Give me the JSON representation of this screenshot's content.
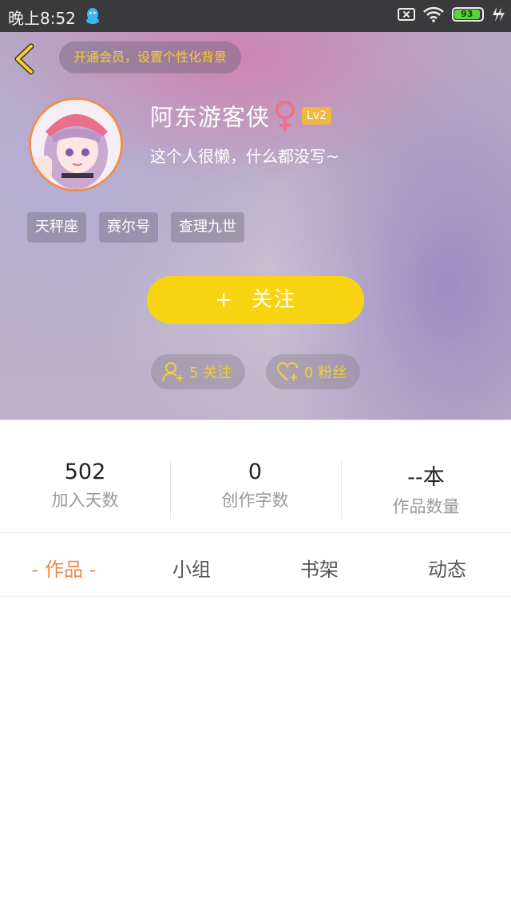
{
  "status_bar": {
    "time": "晚上8:52",
    "battery": "93"
  },
  "header": {
    "vip_prompt": "开通会员，设置个性化背景",
    "username": "阿东游客侠",
    "level": "Lv2",
    "bio": "这个人很懒，什么都没写~",
    "tags": [
      "天秤座",
      "赛尔号",
      "查理九世"
    ],
    "follow_button": {
      "plus": "+",
      "label": "关注"
    },
    "following": "5 关注",
    "fans": "0 粉丝"
  },
  "stats": [
    {
      "value": "502",
      "label": "加入天数"
    },
    {
      "value": "0",
      "label": "创作字数"
    },
    {
      "value": "--本",
      "label": "作品数量"
    }
  ],
  "tabs": [
    {
      "label": "- 作品 -",
      "active": true
    },
    {
      "label": "小组",
      "active": false
    },
    {
      "label": "书架",
      "active": false
    },
    {
      "label": "动态",
      "active": false
    }
  ],
  "colors": {
    "accent_yellow": "#f8d410",
    "active_tab": "#ec8a4f",
    "level_badge": "#f4b73d",
    "gender_icon": "#e7738f"
  }
}
